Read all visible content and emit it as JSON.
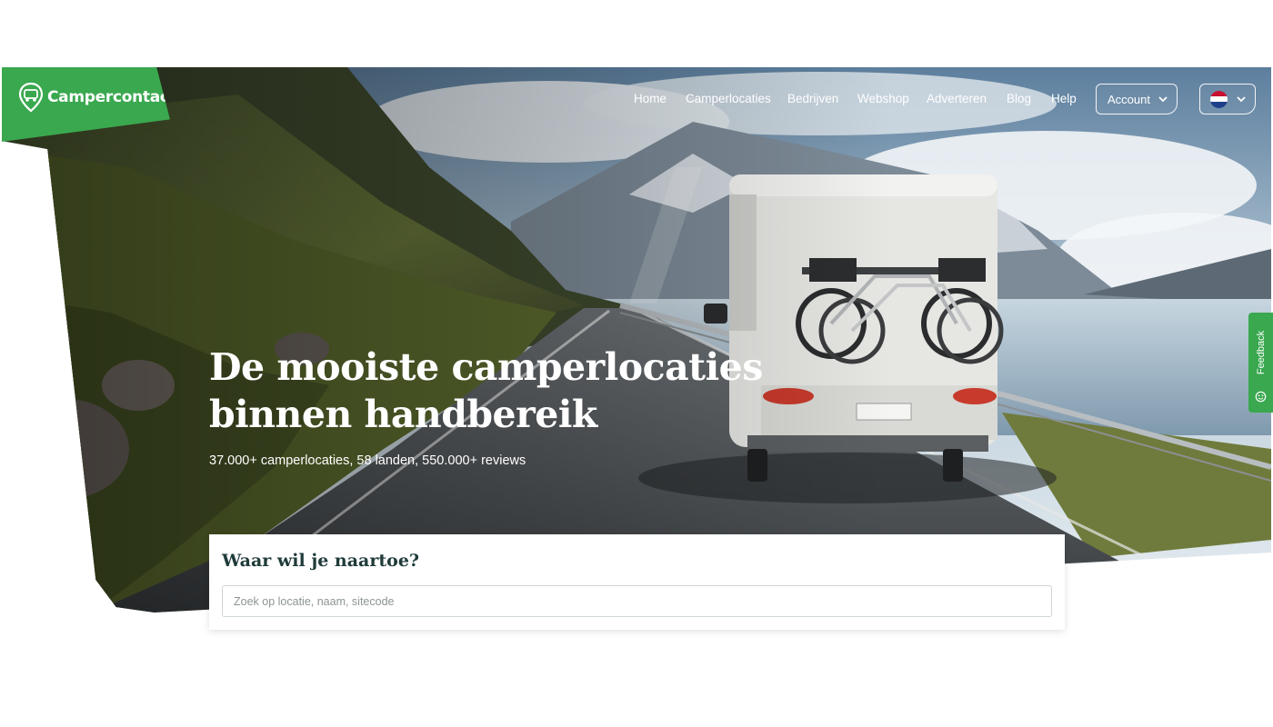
{
  "brand": {
    "name": "Campercontact",
    "color": "#3aa84f"
  },
  "nav": {
    "links": [
      "Home",
      "Camperlocaties",
      "Bedrijven",
      "Webshop",
      "Adverteren",
      "Blog",
      "Help"
    ],
    "account_label": "Account",
    "language_flag": "nl-flag-icon"
  },
  "hero": {
    "title_line1": "De mooiste camperlocaties",
    "title_line2": "binnen handbereik",
    "subtitle": "37.000+ camperlocaties, 58 landen, 550.000+ reviews"
  },
  "search": {
    "title": "Waar wil je naartoe?",
    "placeholder": "Zoek op locatie, naam, sitecode"
  },
  "feedback": {
    "label": "Feedback"
  },
  "icons": {
    "logo": "campercontact-logo-icon",
    "chevron": "chevron-down-icon",
    "feedback": "feedback-icon"
  }
}
